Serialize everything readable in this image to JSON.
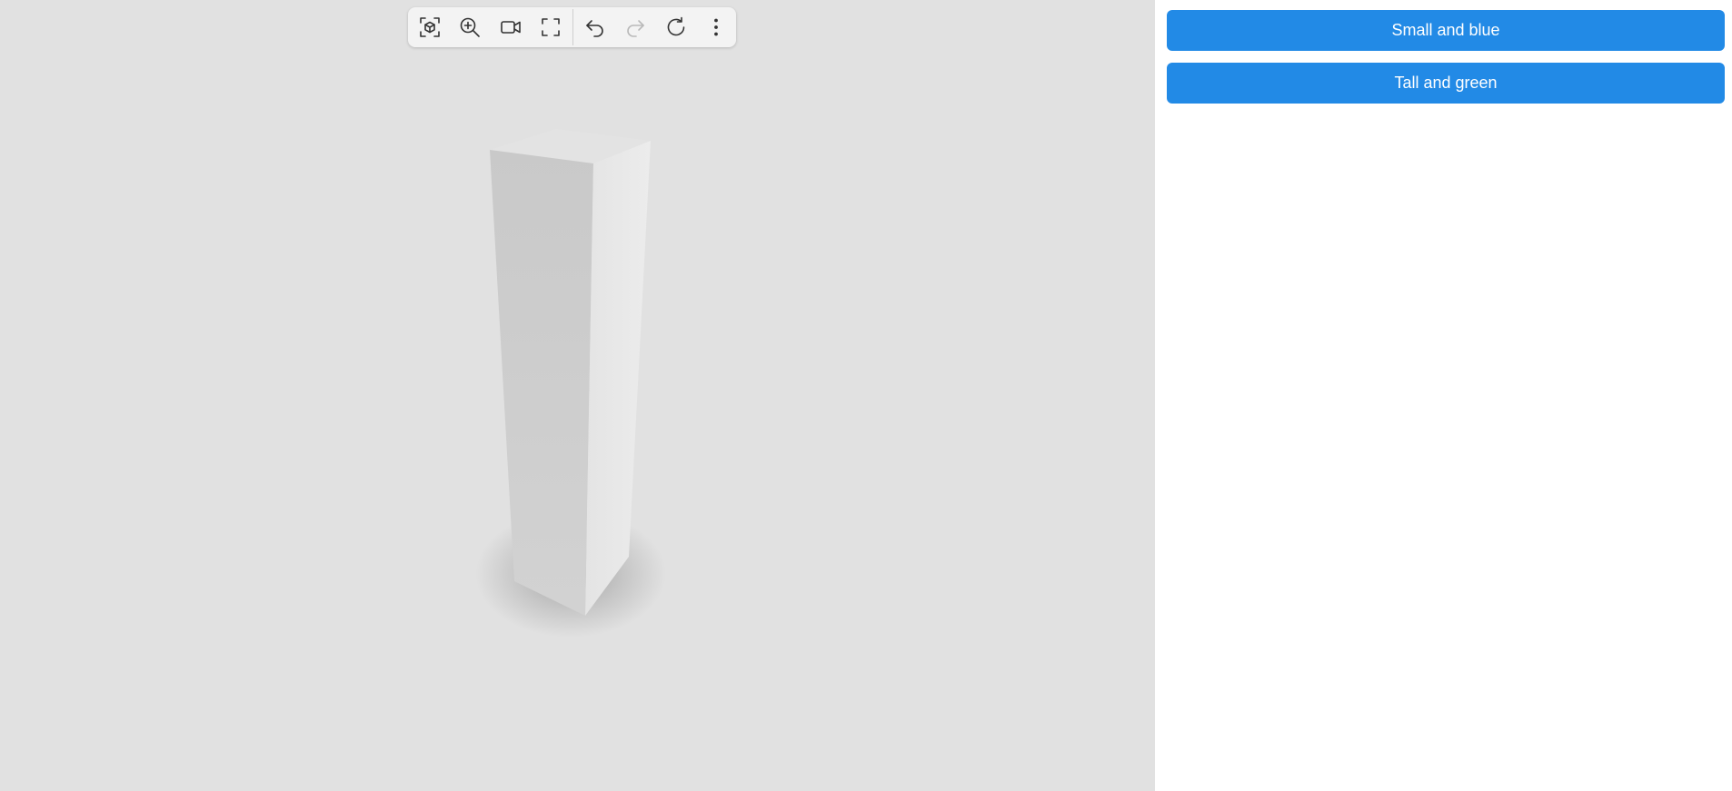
{
  "viewer": {
    "background_color": "#e1e1e1",
    "toolbar": {
      "buttons": [
        {
          "icon": "fit-to-view-icon",
          "enabled": true
        },
        {
          "icon": "zoom-in-icon",
          "enabled": true
        },
        {
          "icon": "camera-icon",
          "enabled": true
        },
        {
          "icon": "fullscreen-icon",
          "enabled": true
        },
        {
          "icon": "undo-icon",
          "enabled": true
        },
        {
          "icon": "redo-icon",
          "enabled": false
        },
        {
          "icon": "reset-icon",
          "enabled": true
        },
        {
          "icon": "more-vertical-icon",
          "enabled": true
        }
      ]
    },
    "model": {
      "shape": "box",
      "face_colors": [
        "#cbcbcb",
        "#e7e7e7",
        "#ececec"
      ]
    }
  },
  "sidebar": {
    "accent_color": "#228ae6",
    "buttons": [
      {
        "label": "Small and blue"
      },
      {
        "label": "Tall and green"
      }
    ]
  }
}
